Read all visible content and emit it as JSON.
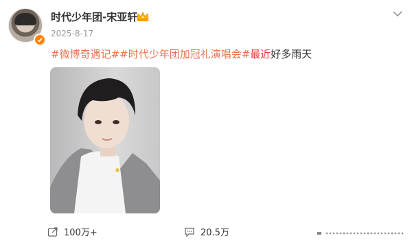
{
  "post": {
    "username": "时代少年团-宋亚轩",
    "date": "2025-8-17",
    "text": {
      "tag1": "#微博奇遇记#",
      "tag2": "#时代少年团加冠礼演唱会#",
      "hot_word": "最近",
      "body": "好多雨天"
    }
  },
  "actions": {
    "repost_count": "100万+",
    "comment_count": "20.5万"
  },
  "icons": {
    "verified": "verified-badge-icon",
    "vip": "crown-icon",
    "menu": "chevron-down-icon",
    "repost": "share-icon",
    "comment": "comment-icon"
  },
  "colors": {
    "topic": "#eb7350",
    "hot_word": "#e63b3b",
    "verified": "#ff8200"
  }
}
